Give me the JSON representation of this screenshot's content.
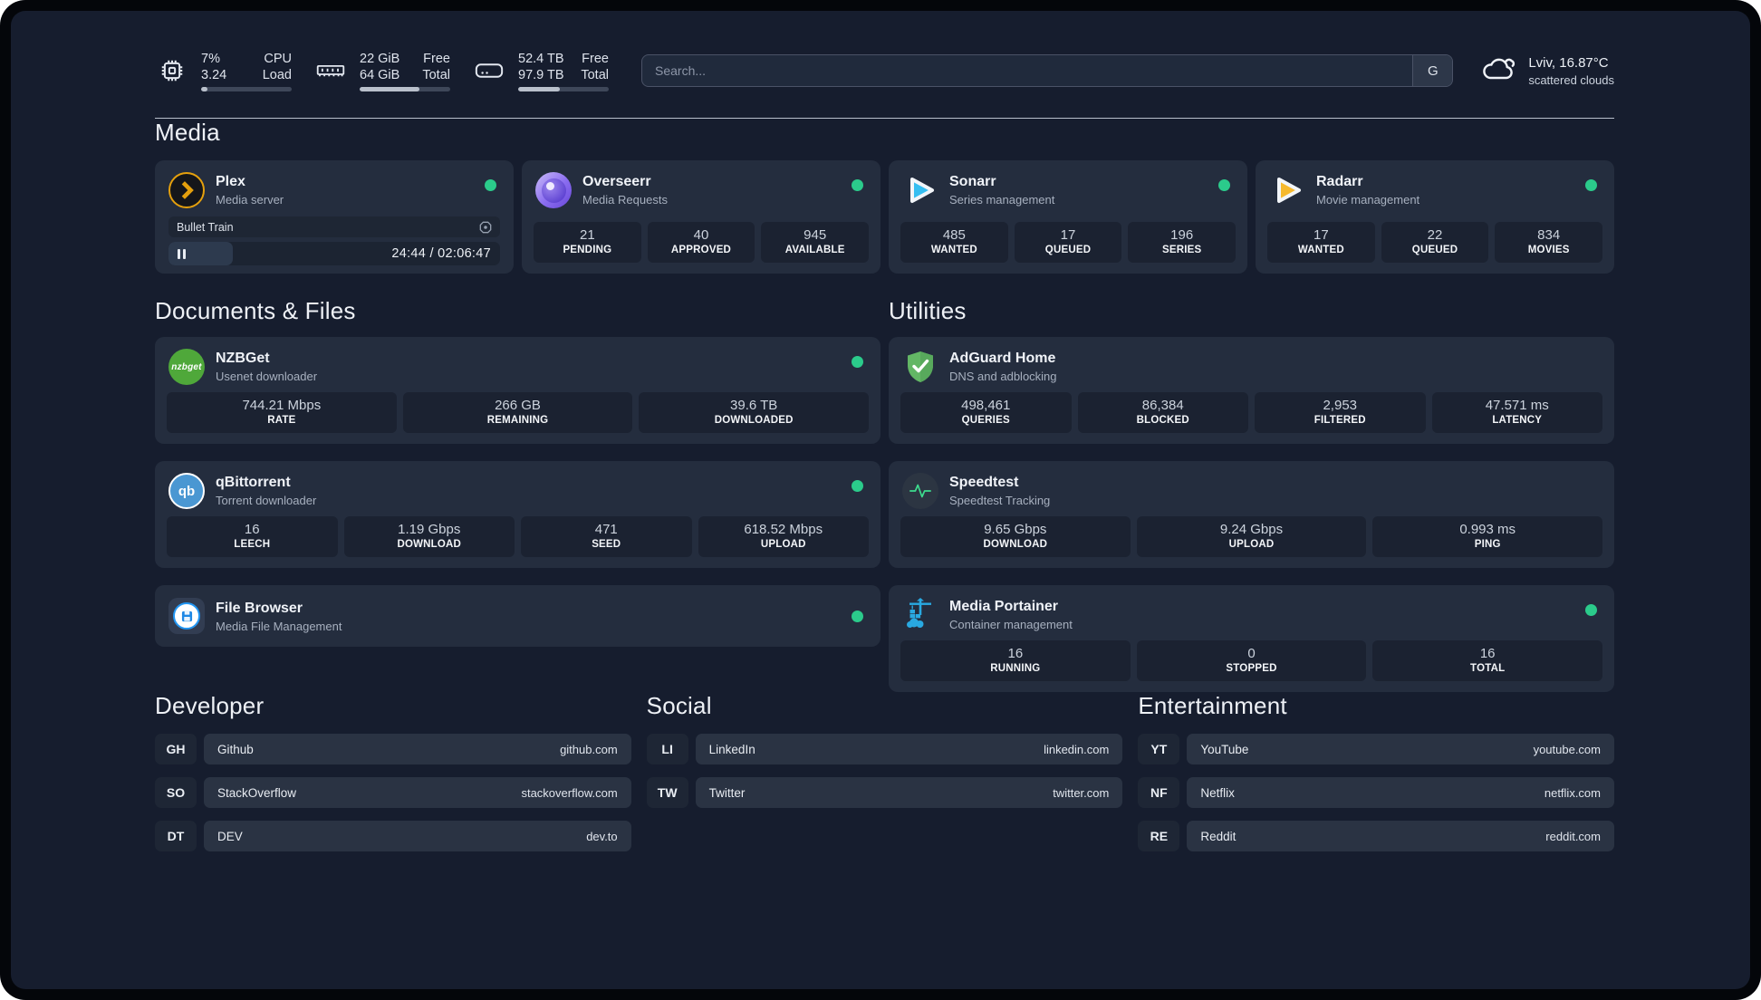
{
  "topbar": {
    "stats": [
      {
        "icon": "cpu-icon",
        "value_top": "7%",
        "value_bottom": "3.24",
        "label_top": "CPU",
        "label_bottom": "Load",
        "progress": 7
      },
      {
        "icon": "ram-icon",
        "value_top": "22 GiB",
        "value_bottom": "64 GiB",
        "label_top": "Free",
        "label_bottom": "Total",
        "progress": 66
      },
      {
        "icon": "disk-icon",
        "value_top": "52.4 TB",
        "value_bottom": "97.9 TB",
        "label_top": "Free",
        "label_bottom": "Total",
        "progress": 46
      }
    ],
    "search": {
      "placeholder": "Search...",
      "button_label": "G"
    },
    "weather": {
      "location_temp": "Lviv, 16.87°C",
      "condition": "scattered clouds"
    }
  },
  "sections": {
    "media": "Media",
    "documents": "Documents & Files",
    "utilities": "Utilities"
  },
  "apps": {
    "plex": {
      "name": "Plex",
      "desc": "Media server",
      "now_playing": "Bullet Train",
      "time": "24:44 / 02:06:47",
      "progress": 19.5
    },
    "overseerr": {
      "name": "Overseerr",
      "desc": "Media Requests",
      "stats": [
        {
          "value": "21",
          "label": "PENDING"
        },
        {
          "value": "40",
          "label": "APPROVED"
        },
        {
          "value": "945",
          "label": "AVAILABLE"
        }
      ]
    },
    "sonarr": {
      "name": "Sonarr",
      "desc": "Series management",
      "stats": [
        {
          "value": "485",
          "label": "WANTED"
        },
        {
          "value": "17",
          "label": "QUEUED"
        },
        {
          "value": "196",
          "label": "SERIES"
        }
      ]
    },
    "radarr": {
      "name": "Radarr",
      "desc": "Movie management",
      "stats": [
        {
          "value": "17",
          "label": "WANTED"
        },
        {
          "value": "22",
          "label": "QUEUED"
        },
        {
          "value": "834",
          "label": "MOVIES"
        }
      ]
    },
    "nzbget": {
      "name": "NZBGet",
      "desc": "Usenet downloader",
      "icon_text": "nzbget",
      "stats": [
        {
          "value": "744.21 Mbps",
          "label": "RATE"
        },
        {
          "value": "266 GB",
          "label": "REMAINING"
        },
        {
          "value": "39.6 TB",
          "label": "DOWNLOADED"
        }
      ]
    },
    "qbittorrent": {
      "name": "qBittorrent",
      "desc": "Torrent downloader",
      "icon_text": "qb",
      "stats": [
        {
          "value": "16",
          "label": "LEECH"
        },
        {
          "value": "1.19 Gbps",
          "label": "DOWNLOAD"
        },
        {
          "value": "471",
          "label": "SEED"
        },
        {
          "value": "618.52 Mbps",
          "label": "UPLOAD"
        }
      ]
    },
    "filebrowser": {
      "name": "File Browser",
      "desc": "Media File Management"
    },
    "adguard": {
      "name": "AdGuard Home",
      "desc": "DNS and adblocking",
      "stats": [
        {
          "value": "498,461",
          "label": "QUERIES"
        },
        {
          "value": "86,384",
          "label": "BLOCKED"
        },
        {
          "value": "2,953",
          "label": "FILTERED"
        },
        {
          "value": "47.571 ms",
          "label": "LATENCY"
        }
      ]
    },
    "speedtest": {
      "name": "Speedtest",
      "desc": "Speedtest Tracking",
      "stats": [
        {
          "value": "9.65 Gbps",
          "label": "DOWNLOAD"
        },
        {
          "value": "9.24 Gbps",
          "label": "UPLOAD"
        },
        {
          "value": "0.993 ms",
          "label": "PING"
        }
      ]
    },
    "portainer": {
      "name": "Media Portainer",
      "desc": "Container management",
      "stats": [
        {
          "value": "16",
          "label": "RUNNING"
        },
        {
          "value": "0",
          "label": "STOPPED"
        },
        {
          "value": "16",
          "label": "TOTAL"
        }
      ]
    }
  },
  "links": {
    "developer": {
      "title": "Developer",
      "items": [
        {
          "abbr": "GH",
          "name": "Github",
          "url": "github.com"
        },
        {
          "abbr": "SO",
          "name": "StackOverflow",
          "url": "stackoverflow.com"
        },
        {
          "abbr": "DT",
          "name": "DEV",
          "url": "dev.to"
        }
      ]
    },
    "social": {
      "title": "Social",
      "items": [
        {
          "abbr": "LI",
          "name": "LinkedIn",
          "url": "linkedin.com"
        },
        {
          "abbr": "TW",
          "name": "Twitter",
          "url": "twitter.com"
        }
      ]
    },
    "entertainment": {
      "title": "Entertainment",
      "items": [
        {
          "abbr": "YT",
          "name": "YouTube",
          "url": "youtube.com"
        },
        {
          "abbr": "NF",
          "name": "Netflix",
          "url": "netflix.com"
        },
        {
          "abbr": "RE",
          "name": "Reddit",
          "url": "reddit.com"
        }
      ]
    }
  },
  "colors": {
    "status_green": "#2bcb8b",
    "plex_amber": "#e5a00d",
    "sonarr_blue": "#35bef1",
    "radarr_yellow": "#f6b92e"
  }
}
